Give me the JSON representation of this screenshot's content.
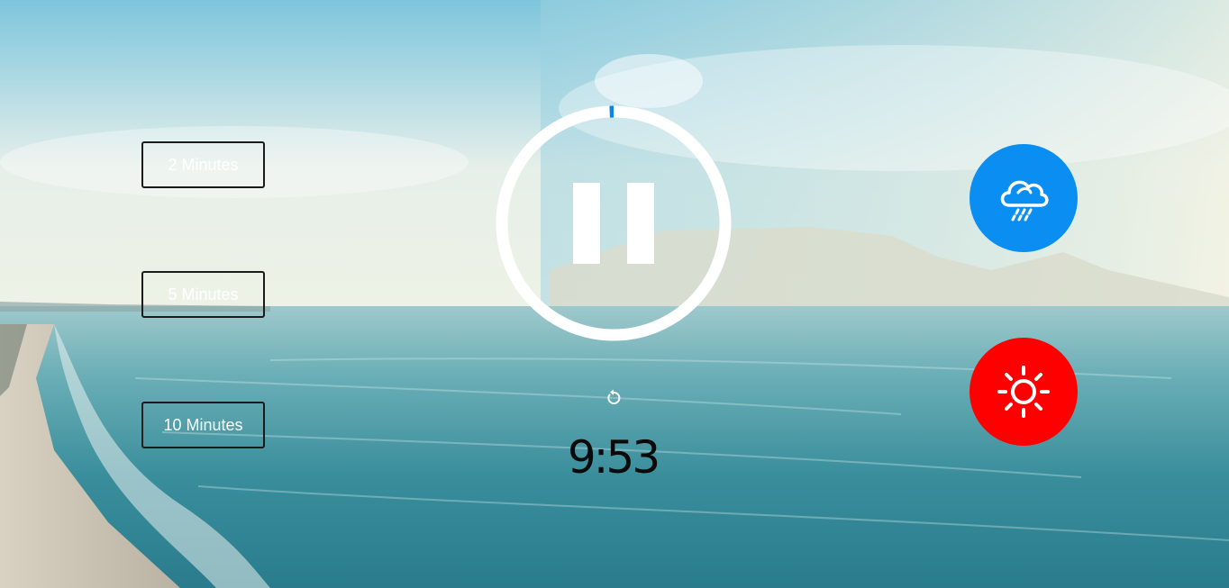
{
  "timeSelect": {
    "options": [
      {
        "label": "2 Minutes"
      },
      {
        "label": "5 Minutes"
      },
      {
        "label": "10 Minutes"
      }
    ]
  },
  "player": {
    "state": "playing",
    "control_icon": "pause-icon",
    "progress_fraction": 0.012,
    "ring_color": "#ffffff",
    "progress_color": "#0a84e6"
  },
  "replay": {
    "icon": "replay-icon"
  },
  "timer": {
    "display": "9:53"
  },
  "sounds": [
    {
      "name": "rain",
      "icon": "cloud-rain-icon",
      "color": "#0b8ef2"
    },
    {
      "name": "summer",
      "icon": "sun-icon",
      "color": "#ff0000"
    }
  ]
}
